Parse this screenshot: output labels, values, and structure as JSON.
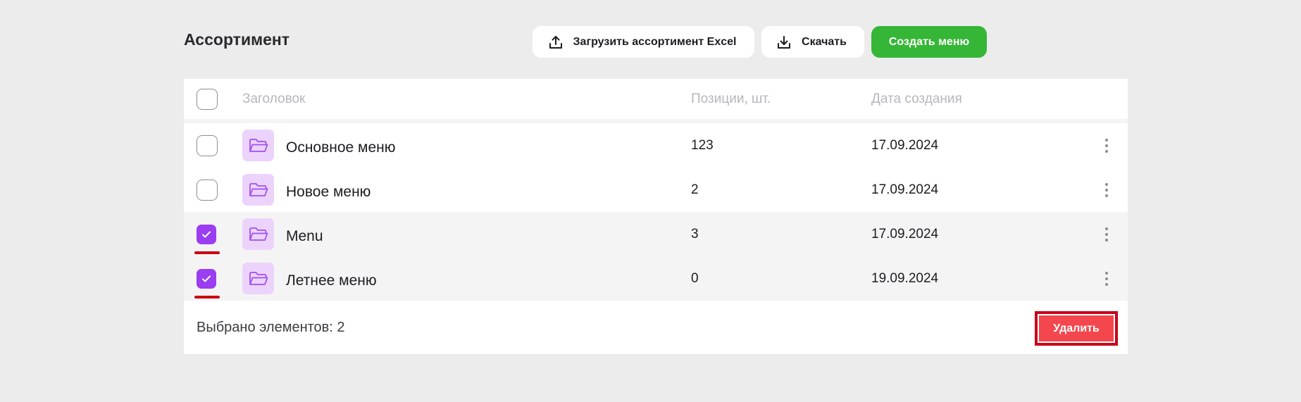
{
  "header": {
    "title": "Ассортимент",
    "upload_label": "Загрузить ассортимент Excel",
    "download_label": "Скачать",
    "create_label": "Создать меню"
  },
  "table": {
    "columns": {
      "title": "Заголовок",
      "positions": "Позиции, шт.",
      "created": "Дата создания"
    },
    "rows": [
      {
        "name": "Основное меню",
        "positions": "123",
        "date": "17.09.2024",
        "checked": false
      },
      {
        "name": "Новое меню",
        "positions": "2",
        "date": "17.09.2024",
        "checked": false
      },
      {
        "name": "Menu",
        "positions": "3",
        "date": "17.09.2024",
        "checked": true
      },
      {
        "name": "Летнее меню",
        "positions": "0",
        "date": "19.09.2024",
        "checked": true
      }
    ]
  },
  "footer": {
    "selected_text": "Выбрано элементов: 2",
    "delete_label": "Удалить"
  },
  "colors": {
    "accent_purple": "#9b3df0",
    "green": "#36b636",
    "danger": "#f4474d",
    "highlight_red": "#c8001a"
  },
  "icons": [
    "upload-icon",
    "download-icon",
    "folder-icon",
    "check-icon",
    "more-vertical-icon"
  ]
}
